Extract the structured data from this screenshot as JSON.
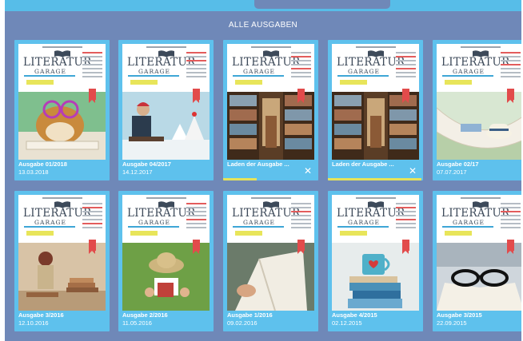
{
  "header": {
    "section_title": "ALLE AUSGABEN"
  },
  "cover": {
    "title_line1": "LITERATUR",
    "title_line2": "GARAGE"
  },
  "colors": {
    "tile": "#5ec1ed",
    "background": "#6f88b8",
    "progress": "#e6e35a",
    "bookmark": "#e24b4b"
  },
  "issues": [
    {
      "title": "Ausgabe 01/2018",
      "date": "13.03.2018",
      "photo": "guinea-pig-glasses"
    },
    {
      "title": "Ausgabe 04/2017",
      "date": "14.12.2017",
      "photo": "man-reading-winter"
    },
    {
      "title": "Laden der Ausgabe ...",
      "date": "",
      "photo": "library-shelves",
      "progress": 0.35,
      "cancel_icon": "close-icon"
    },
    {
      "title": "Laden der Ausgabe ...",
      "date": "",
      "photo": "library-shelves",
      "progress": 0.98,
      "cancel_icon": "close-icon"
    },
    {
      "title": "Ausgabe 02/17",
      "date": "07.07.2017",
      "photo": "hammock-hat"
    },
    {
      "title": "Ausgabe 3/2016",
      "date": "12.10.2016",
      "photo": "girl-reading-books"
    },
    {
      "title": "Ausgabe 2/2016",
      "date": "11.05.2016",
      "photo": "hat-on-grass"
    },
    {
      "title": "Ausgabe 1/2016",
      "date": "09.02.2016",
      "photo": "open-book-hand"
    },
    {
      "title": "Ausgabe 4/2015",
      "date": "02.12.2015",
      "photo": "books-and-mug"
    },
    {
      "title": "Ausgabe 3/2015",
      "date": "22.09.2015",
      "photo": "glasses-on-book"
    }
  ]
}
